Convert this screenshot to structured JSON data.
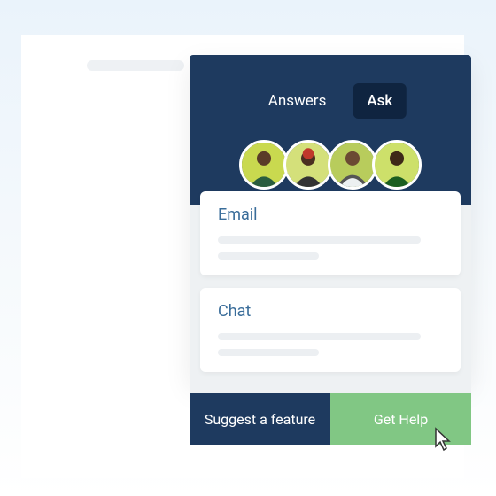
{
  "widget": {
    "tabs": {
      "answers": "Answers",
      "ask": "Ask"
    },
    "options": {
      "email": {
        "title": "Email"
      },
      "chat": {
        "title": "Chat"
      }
    }
  },
  "footer": {
    "suggest_label": "Suggest a feature",
    "help_label": "Get Help"
  },
  "colors": {
    "header_bg": "#1e3a5f",
    "active_tab_bg": "#0f2440",
    "option_title": "#3a6d9a",
    "help_button": "#81c784"
  }
}
